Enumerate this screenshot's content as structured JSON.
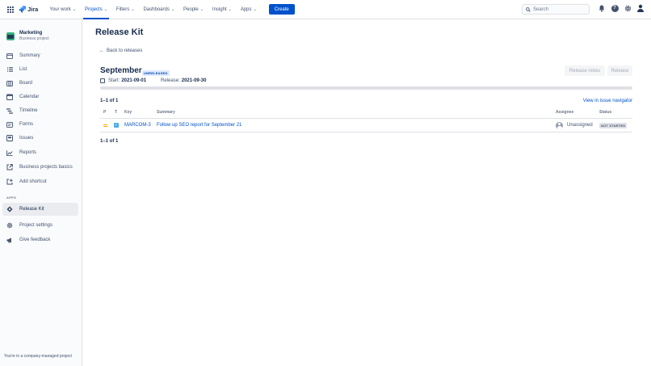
{
  "topnav": {
    "logo_text": "Jira",
    "items": [
      {
        "label": "Your work"
      },
      {
        "label": "Projects"
      },
      {
        "label": "Filters"
      },
      {
        "label": "Dashboards"
      },
      {
        "label": "People"
      },
      {
        "label": "Insight"
      },
      {
        "label": "Apps"
      }
    ],
    "active_item": "Projects",
    "create_label": "Create",
    "search_placeholder": "Search",
    "icons": [
      "bell-icon",
      "help-icon",
      "gear-icon",
      "avatar"
    ]
  },
  "sidebar": {
    "project_name": "Marketing",
    "project_type": "Business project",
    "items": [
      {
        "label": "Summary",
        "icon": "summary-icon"
      },
      {
        "label": "List",
        "icon": "list-icon"
      },
      {
        "label": "Board",
        "icon": "board-icon"
      },
      {
        "label": "Calendar",
        "icon": "calendar-icon"
      },
      {
        "label": "Timeline",
        "icon": "timeline-icon"
      },
      {
        "label": "Forms",
        "icon": "forms-icon"
      },
      {
        "label": "Issues",
        "icon": "issues-icon"
      },
      {
        "label": "Reports",
        "icon": "reports-icon"
      },
      {
        "label": "Business projects basics",
        "icon": "external-link-icon"
      },
      {
        "label": "Add shortcut",
        "icon": "add-shortcut-icon"
      }
    ],
    "apps_heading": "APPS",
    "app_items": [
      {
        "label": "Release Kit",
        "icon": "release-kit-icon",
        "active": true
      }
    ],
    "footer_items": [
      {
        "label": "Project settings",
        "icon": "gear-icon"
      },
      {
        "label": "Give feedback",
        "icon": "megaphone-icon"
      }
    ],
    "company_note": "You're in a company-managed project"
  },
  "main": {
    "title": "Release Kit",
    "back_link": "Back to releases",
    "version": {
      "name": "September",
      "status": "UNRELEASED",
      "start_label": "Start:",
      "start_date": "2021-09-01",
      "release_label": "Release:",
      "release_date": "2021-09-30",
      "progress_fraction": 0
    },
    "buttons": {
      "release_notes": "Release notes",
      "release": "Release"
    },
    "count_top": "1–1 of 1",
    "count_bottom": "1–1 of 1",
    "view_link": "View in issue navigator",
    "columns": [
      "P",
      "T",
      "Key",
      "Summary",
      "Assignee",
      "Status"
    ],
    "issues": [
      {
        "priority": "medium",
        "type": "task",
        "key": "MARCOM-3",
        "summary": "Follow up SEO report for September 21",
        "assignee": "Unassigned",
        "status": "NOT STARTED"
      }
    ]
  },
  "colors": {
    "brand": "#0052cc",
    "text": "#172b4d",
    "subtle": "#42526e",
    "border": "#dfe1e6",
    "priority_medium": "#ffab00",
    "task_blue": "#4bade8"
  }
}
